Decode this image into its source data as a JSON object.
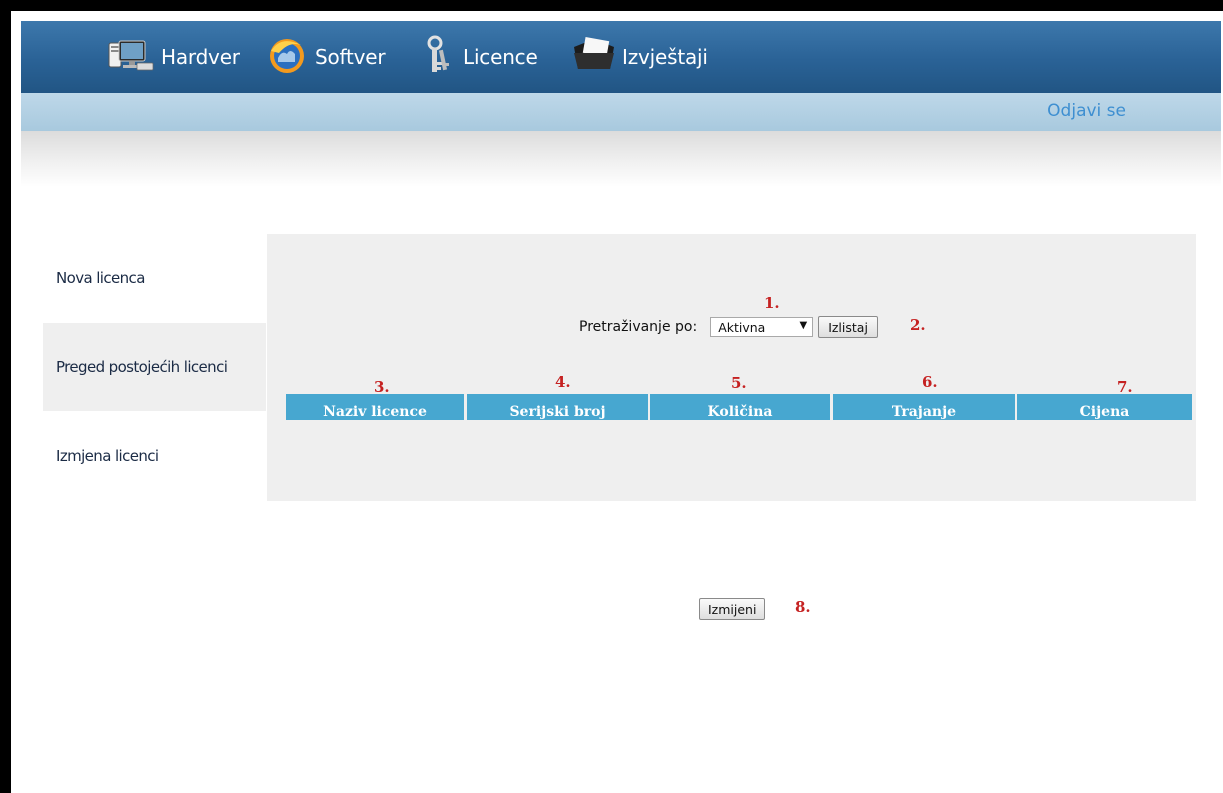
{
  "nav": {
    "items": [
      {
        "label": "Hardver",
        "icon": "computer-icon"
      },
      {
        "label": "Softver",
        "icon": "globe-icon"
      },
      {
        "label": "Licence",
        "icon": "keys-icon"
      },
      {
        "label": "Izvještaji",
        "icon": "folder-icon"
      }
    ],
    "logout_label": "Odjavi se"
  },
  "sidebar": {
    "items": [
      {
        "label": "Nova licenca",
        "active": false
      },
      {
        "label": "Preged postojećih licenci",
        "active": true
      },
      {
        "label": "Izmjena licenci",
        "active": false
      }
    ]
  },
  "search": {
    "label": "Pretraživanje po:",
    "selected": "Aktivna",
    "button_label": "Izlistaj"
  },
  "table": {
    "columns": [
      "Naziv licence",
      "Serijski broj",
      "Količina",
      "Trajanje",
      "Cijena"
    ]
  },
  "annotations": [
    "1.",
    "2.",
    "3.",
    "4.",
    "5.",
    "6.",
    "7.",
    "8."
  ],
  "footer": {
    "button_label": "Izmijeni"
  },
  "colors": {
    "nav_bg": "#2a6296",
    "subbar_bg": "#b5d2e5",
    "header_cell": "#47a7d0",
    "annotation": "#c52121",
    "logout": "#3e8fd1"
  }
}
